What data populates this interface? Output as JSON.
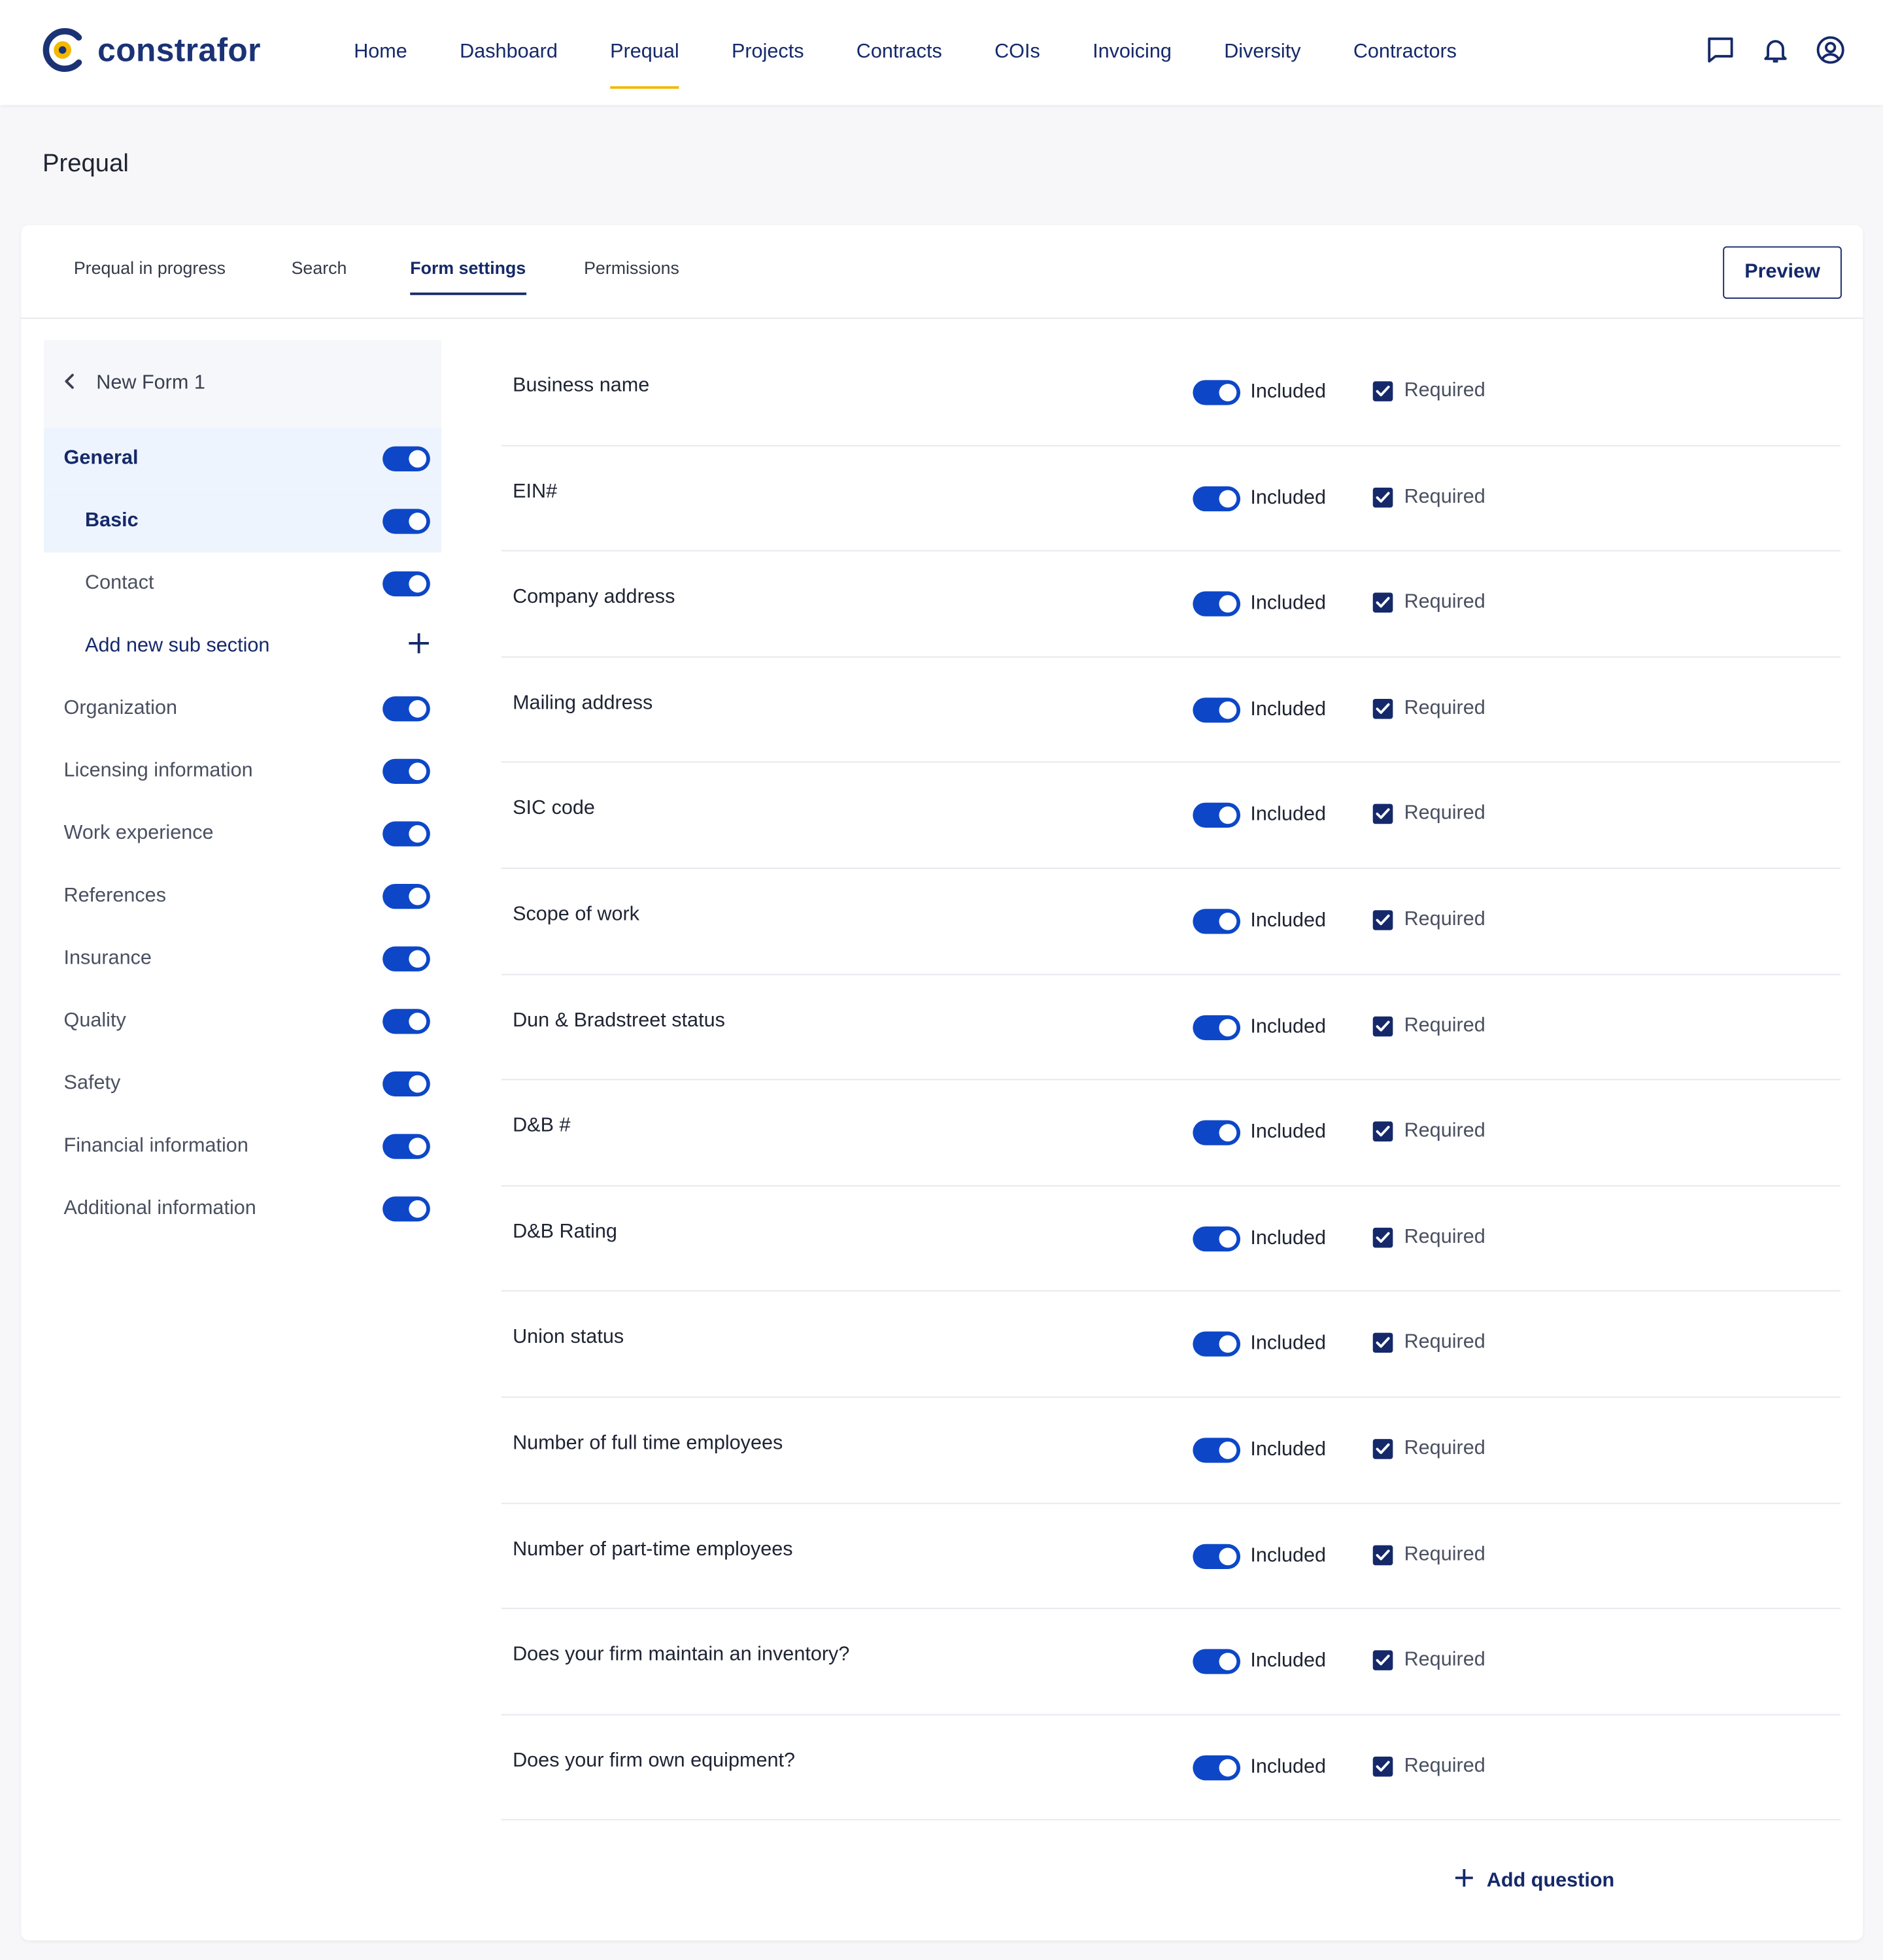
{
  "brand": {
    "name": "constrafor"
  },
  "nav": {
    "links": [
      "Home",
      "Dashboard",
      "Prequal",
      "Projects",
      "Contracts",
      "COIs",
      "Invoicing",
      "Diversity",
      "Contractors"
    ],
    "active": "Prequal",
    "icons": [
      "chat-icon",
      "bell-icon",
      "user-circle-icon"
    ]
  },
  "page": {
    "title": "Prequal"
  },
  "tabs": {
    "items": [
      "Prequal in progress",
      "Search",
      "Form settings",
      "Permissions"
    ],
    "active": "Form settings",
    "preview_label": "Preview"
  },
  "sidebar": {
    "form_name": "New Form 1",
    "items": [
      {
        "label": "General",
        "level": 0,
        "toggle": true,
        "active": true
      },
      {
        "label": "Basic",
        "level": 1,
        "toggle": true,
        "active": true
      },
      {
        "label": "Contact",
        "level": 1,
        "toggle": true,
        "active": false
      },
      {
        "label": "Add new sub section",
        "level": 1,
        "toggle": false,
        "add": true
      },
      {
        "label": "Organization",
        "level": 0,
        "toggle": true
      },
      {
        "label": "Licensing information",
        "level": 0,
        "toggle": true
      },
      {
        "label": "Work experience",
        "level": 0,
        "toggle": true
      },
      {
        "label": "References",
        "level": 0,
        "toggle": true
      },
      {
        "label": "Insurance",
        "level": 0,
        "toggle": true
      },
      {
        "label": "Quality",
        "level": 0,
        "toggle": true
      },
      {
        "label": "Safety",
        "level": 0,
        "toggle": true
      },
      {
        "label": "Financial information",
        "level": 0,
        "toggle": true
      },
      {
        "label": "Additional information",
        "level": 0,
        "toggle": true
      }
    ]
  },
  "questions": {
    "included_label": "Included",
    "required_label": "Required",
    "items": [
      {
        "label": "Business name",
        "included": true,
        "required": true
      },
      {
        "label": "EIN#",
        "included": true,
        "required": true
      },
      {
        "label": "Company address",
        "included": true,
        "required": true
      },
      {
        "label": "Mailing address",
        "included": true,
        "required": true
      },
      {
        "label": "SIC code",
        "included": true,
        "required": true
      },
      {
        "label": "Scope of work",
        "included": true,
        "required": true
      },
      {
        "label": "Dun & Bradstreet status",
        "included": true,
        "required": true
      },
      {
        "label": "D&B #",
        "included": true,
        "required": true
      },
      {
        "label": "D&B Rating",
        "included": true,
        "required": true
      },
      {
        "label": "Union status",
        "included": true,
        "required": true
      },
      {
        "label": "Number of full time employees",
        "included": true,
        "required": true
      },
      {
        "label": "Number of part-time employees",
        "included": true,
        "required": true
      },
      {
        "label": "Does your firm maintain an inventory?",
        "included": true,
        "required": true
      },
      {
        "label": "Does your firm own equipment?",
        "included": true,
        "required": true
      }
    ],
    "add_label": "Add question"
  },
  "colors": {
    "primary": "#15296a",
    "toggle": "#0d47c8",
    "accent": "#f3b800"
  }
}
